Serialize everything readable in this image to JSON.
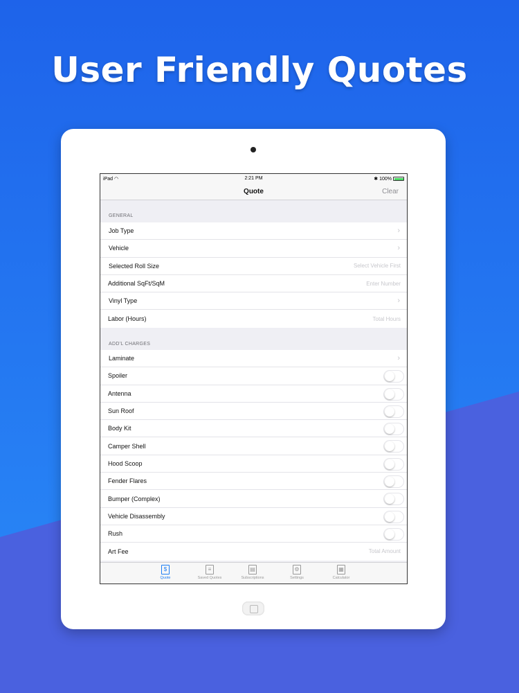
{
  "headline": "User Friendly Quotes",
  "status_bar": {
    "carrier": "iPad",
    "time": "2:21 PM",
    "battery": "100%"
  },
  "nav": {
    "title": "Quote",
    "clear_label": "Clear"
  },
  "sections": {
    "general": {
      "header": "GENERAL",
      "rows": [
        {
          "label": "Job Type",
          "accessory": "chevron"
        },
        {
          "label": "Vehicle",
          "accessory": "chevron"
        },
        {
          "label": "Selected Roll Size",
          "placeholder": "Select Vehicle First"
        },
        {
          "label": "Additional SqFt/SqM",
          "placeholder": "Enter Number"
        },
        {
          "label": "Vinyl Type",
          "accessory": "chevron"
        },
        {
          "label": "Labor (Hours)",
          "placeholder": "Total Hours"
        }
      ]
    },
    "charges": {
      "header": "ADD'L CHARGES",
      "rows": [
        {
          "label": "Laminate",
          "accessory": "chevron"
        },
        {
          "label": "Spoiler",
          "toggle": false
        },
        {
          "label": "Antenna",
          "toggle": false
        },
        {
          "label": "Sun Roof",
          "toggle": false
        },
        {
          "label": "Body Kit",
          "toggle": false
        },
        {
          "label": "Camper Shell",
          "toggle": false
        },
        {
          "label": "Hood Scoop",
          "toggle": false
        },
        {
          "label": "Fender Flares",
          "toggle": false
        },
        {
          "label": "Bumper (Complex)",
          "toggle": false
        },
        {
          "label": "Vehicle Disassembly",
          "toggle": false
        },
        {
          "label": "Rush",
          "toggle": false
        },
        {
          "label": "Art Fee",
          "placeholder": "Total Amount"
        }
      ]
    }
  },
  "tabs": [
    {
      "label": "Quote",
      "icon": "dollar-icon",
      "glyph": "$",
      "active": true
    },
    {
      "label": "Saved Quotes",
      "icon": "list-icon",
      "glyph": "≡",
      "active": false
    },
    {
      "label": "Subscriptions",
      "icon": "subscriptions-icon",
      "glyph": "▤",
      "active": false
    },
    {
      "label": "Settings",
      "icon": "gear-icon",
      "glyph": "⚙",
      "active": false
    },
    {
      "label": "Calculator",
      "icon": "calculator-icon",
      "glyph": "▦",
      "active": false
    }
  ],
  "colors": {
    "background_top": "#1e63ea",
    "background_bottom": "#4a61df",
    "accent": "#1a7cf4"
  }
}
